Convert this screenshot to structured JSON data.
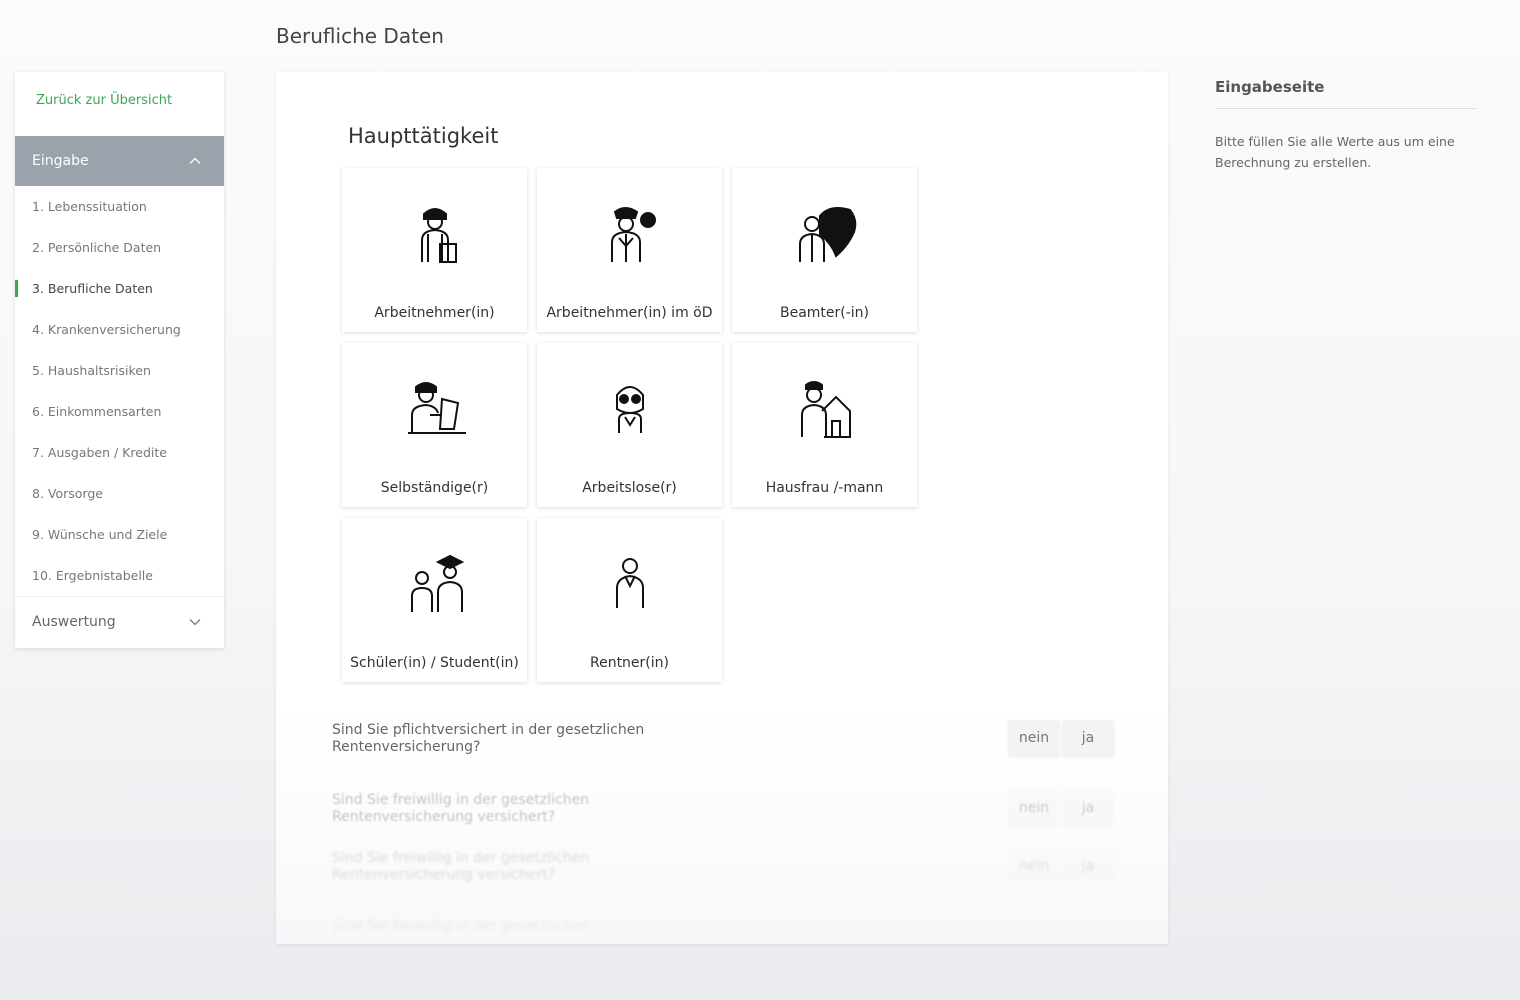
{
  "page": {
    "title": "Berufliche Daten"
  },
  "sidebar": {
    "back_link": "Zurück zur Übersicht",
    "section_open": "Eingabe",
    "items": [
      {
        "label": "1. Lebenssituation"
      },
      {
        "label": "2. Persönliche Daten"
      },
      {
        "label": "3. Berufliche Daten",
        "active": true
      },
      {
        "label": "4. Krankenversicherung"
      },
      {
        "label": "5. Haushaltsrisiken"
      },
      {
        "label": "6. Einkommensarten"
      },
      {
        "label": "7. Ausgaben / Kredite"
      },
      {
        "label": "8. Vorsorge"
      },
      {
        "label": "9. Wünsche und Ziele"
      },
      {
        "label": "10. Ergebnistabelle"
      }
    ],
    "section_closed": "Auswertung",
    "accent_color": "#3aa854"
  },
  "main": {
    "section_title": "Haupttätigkeit",
    "tiles": [
      {
        "label": "Arbeitnehmer(in)",
        "icon": "employee-icon"
      },
      {
        "label": "Arbeitnehmer(in) im öD",
        "icon": "public-service-employee-icon"
      },
      {
        "label": "Beamter(-in)",
        "icon": "civil-servant-eagle-icon"
      },
      {
        "label": "Selbständige(r)",
        "icon": "self-employed-laptop-icon"
      },
      {
        "label": "Arbeitslose(r)",
        "icon": "unemployed-icon"
      },
      {
        "label": "Hausfrau /-mann",
        "icon": "homemaker-house-icon"
      },
      {
        "label": "Schüler(in) / Student(in)",
        "icon": "student-graduate-icon"
      },
      {
        "label": "Rentner(in)",
        "icon": "retiree-icon"
      }
    ],
    "questions": [
      {
        "text": "Sind Sie pflichtversichert in der gesetzlichen Rentenversicherung?",
        "no": "nein",
        "yes": "ja"
      },
      {
        "text": "Sind Sie freiwillig in der gesetzlichen Rentenversicherung versichert?",
        "no": "nein",
        "yes": "ja"
      },
      {
        "text": "Sind Sie freiwillig in der gesetzlichen Rentenversicherung versichert?",
        "no": "nein",
        "yes": "ja"
      },
      {
        "text": "Sind Sie freiwillig in der gesetzlichen Rentenversicherung versichert?",
        "no": "",
        "yes": ""
      }
    ]
  },
  "info": {
    "title": "Eingabeseite",
    "text": "Bitte füllen Sie alle Werte aus um eine Berechnung zu erstellen."
  }
}
